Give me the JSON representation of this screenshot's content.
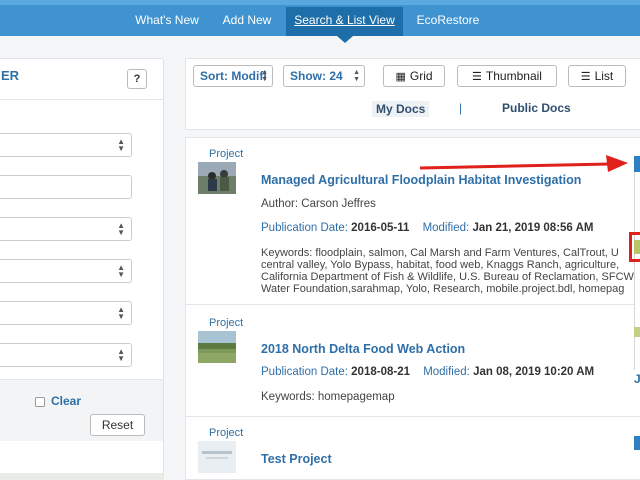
{
  "nav": {
    "items": [
      {
        "label": "What's New",
        "active": false
      },
      {
        "label": "Add New",
        "active": false
      },
      {
        "label": "Search & List View",
        "active": true
      },
      {
        "label": "EcoRestore",
        "active": false
      }
    ]
  },
  "filter": {
    "title": "ER",
    "help_label": "?",
    "clear_label": "Clear",
    "reset_label": "Reset"
  },
  "toolbar": {
    "sort_label": "Sort: Modifi",
    "show_label": "Show: 24",
    "grid_label": "Grid",
    "thumbnail_label": "Thumbnail",
    "list_label": "List",
    "my_docs": "My Docs",
    "separator": "|",
    "public_docs": "Public Docs"
  },
  "labels": {
    "publication_date": "Publication Date:",
    "modified": "Modified:"
  },
  "results": [
    {
      "type": "Project",
      "title": "Managed Agricultural Floodplain Habitat Investigation",
      "author": "Author: Carson Jeffres",
      "publication_date": "2016-05-11",
      "modified": "Jan 21, 2019 08:56 AM",
      "keywords": "Keywords: floodplain, salmon, Cal Marsh and Farm Ventures, CalTrout, U central valley, Yolo Bypass, habitat, food web, Knaggs Ranch, agriculture, California Department of Fish & Wildlife, U.S. Bureau of Reclamation, SFCW Water Foundation,sarahmap, Yolo, Research, mobile.project.bdl, homepag"
    },
    {
      "type": "Project",
      "title": "2018 North Delta Food Web Action",
      "publication_date": "2018-08-21",
      "modified": "Jan 08, 2019 10:20 AM",
      "keywords": "Keywords: homepagemap"
    },
    {
      "type": "Project",
      "title": "Test Project"
    }
  ],
  "side": {
    "letter": "J"
  },
  "colors": {
    "nav_bg": "#3f93d1",
    "nav_active": "#1e6fa9",
    "link_blue": "#2f6fa7",
    "annotation_red": "#e0201b"
  }
}
